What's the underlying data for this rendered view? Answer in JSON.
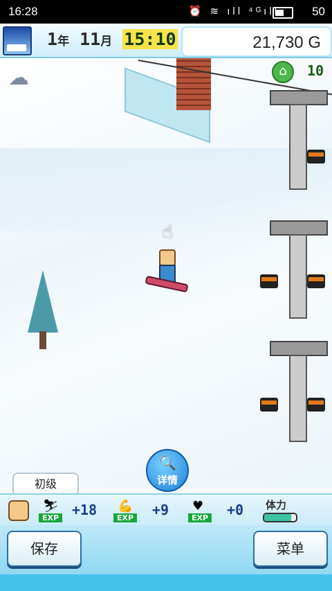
{
  "status_bar": {
    "time": "16:28",
    "icons": "⏰ ≋ ıll ⁴ᴳıll",
    "battery": "50"
  },
  "header": {
    "year": "1",
    "year_unit": "年",
    "month": "11",
    "month_unit": "月",
    "time": "15:10",
    "money": "21,730 G"
  },
  "map": {
    "rank_value": "10",
    "weather_icon": "partly-cloudy-icon"
  },
  "detail_button": {
    "label": "详情"
  },
  "level_bubble": {
    "text": "初级"
  },
  "stats": {
    "exp1": "+18",
    "exp2": "+9",
    "exp3": "+0",
    "exp_label": "EXP",
    "stamina_label": "体力",
    "stamina_level": 0.85
  },
  "buttons": {
    "save": "保存",
    "menu": "菜单"
  }
}
